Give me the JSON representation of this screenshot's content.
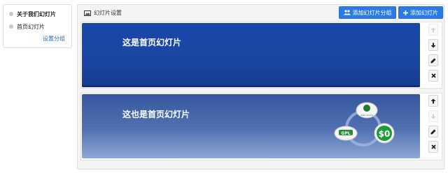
{
  "groups": {
    "items": [
      {
        "label": "关于我们幻灯片",
        "active": true
      },
      {
        "label": "首页幻灯片",
        "active": false
      }
    ],
    "settings_link": "设置分组"
  },
  "main": {
    "title": "幻灯片设置",
    "add_group_label": "添加幻灯片分组",
    "add_slide_label": "添加幻灯片"
  },
  "slides": [
    {
      "title": "这是首页幻灯片",
      "bg_color": "#1a46a2",
      "actions": {
        "move_up_enabled": false,
        "move_down_enabled": true
      }
    },
    {
      "title": "这也是首页幻灯片",
      "bg_color": "#5271b1",
      "art": {
        "badge_top": "open source",
        "badge_left": "GPL",
        "badge_right": "$0"
      },
      "actions": {
        "move_up_enabled": true,
        "move_down_enabled": false
      }
    }
  ],
  "colors": {
    "primary": "#2c7be5",
    "link": "#2a6aa8"
  }
}
